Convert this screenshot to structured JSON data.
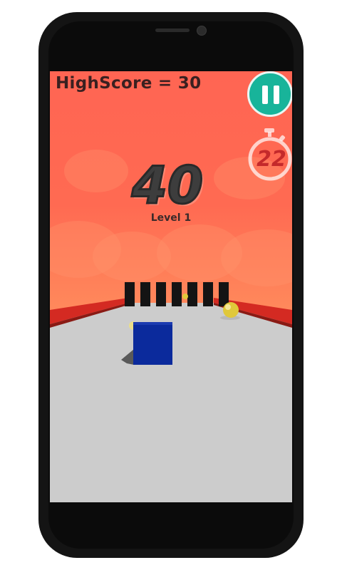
{
  "hud": {
    "highscore_label": "HighScore = 30",
    "score": "40",
    "level": "Level 1",
    "timer": "22"
  },
  "icons": {
    "pause": "pause-icon",
    "timer": "stopwatch-icon"
  },
  "colors": {
    "sky": "#ff6553",
    "road": "#cccccc",
    "rail": "#d42a22",
    "player_cube": "#0b2a9c",
    "pause_button": "#18b49a",
    "timer": "#c4292b",
    "ball": "#e0c83a"
  }
}
